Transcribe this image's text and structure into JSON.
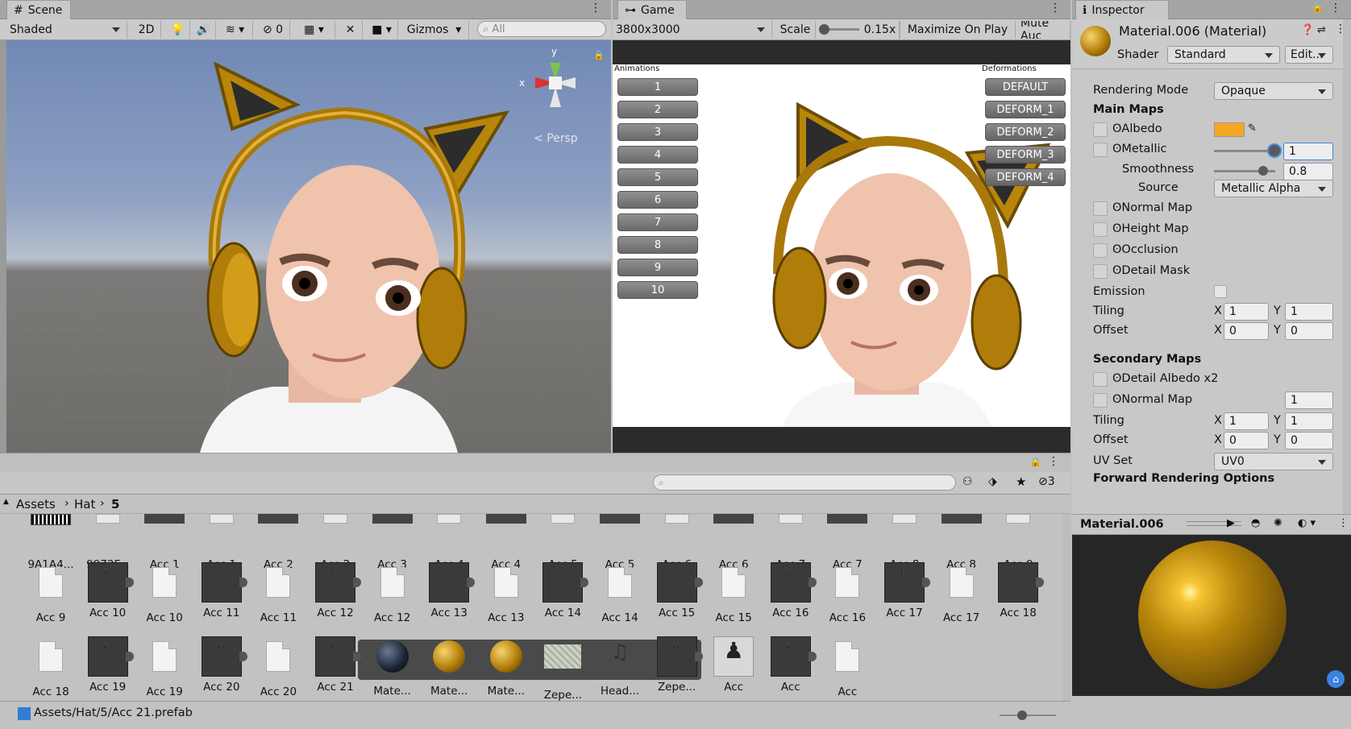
{
  "scene": {
    "tab": "Scene",
    "shading": "Shaded",
    "mode_2d": "2D",
    "hidden_count": "0",
    "gizmos": "Gizmos",
    "search_placeholder": "All",
    "axis_y": "y",
    "axis_x": "x",
    "persp": "Persp"
  },
  "game": {
    "tab": "Game",
    "resolution": "3800x3000",
    "scale_label": "Scale",
    "scale_value": "0.15x",
    "maximize": "Maximize On Play",
    "mute": "Mute Auc",
    "animations_title": "Animations",
    "deformations_title": "Deformations",
    "animations": [
      "1",
      "2",
      "3",
      "4",
      "5",
      "6",
      "7",
      "8",
      "9",
      "10"
    ],
    "deformations": [
      "DEFAULT",
      "DEFORM_1",
      "DEFORM_2",
      "DEFORM_3",
      "DEFORM_4"
    ]
  },
  "inspector": {
    "tab": "Inspector",
    "title": "Material.006 (Material)",
    "shader_label": "Shader",
    "shader": "Standard",
    "edit": "Edit...",
    "rendering_mode_label": "Rendering Mode",
    "rendering_mode": "Opaque",
    "main_maps": "Main Maps",
    "albedo": "Albedo",
    "metallic": "Metallic",
    "metallic_value": "1",
    "smoothness": "Smoothness",
    "smoothness_value": "0.8",
    "source": "Source",
    "source_value": "Metallic Alpha",
    "normal_map": "Normal Map",
    "height_map": "Height Map",
    "occlusion": "Occlusion",
    "detail_mask": "Detail Mask",
    "emission": "Emission",
    "tiling": "Tiling",
    "offset": "Offset",
    "x": "X",
    "y": "Y",
    "tiling_x": "1",
    "tiling_y": "1",
    "offset_x": "0",
    "offset_y": "0",
    "secondary_maps": "Secondary Maps",
    "detail_albedo": "Detail Albedo x2",
    "normal_map2": "Normal Map",
    "normal_map2_value": "1",
    "tiling2_x": "1",
    "tiling2_y": "1",
    "offset2_x": "0",
    "offset2_y": "0",
    "uv_set": "UV Set",
    "uv_set_value": "UV0",
    "forward": "Forward Rendering Options",
    "preview_name": "Material.006",
    "albedo_color": "#f5a623"
  },
  "project": {
    "breadcrumb": [
      "Assets",
      "Hat",
      "5"
    ],
    "hidden_count": "3",
    "status_path": "Assets/Hat/5/Acc 21.prefab",
    "row0": [
      "9A1A4...",
      "9972F...",
      "Acc 1",
      "Acc 1",
      "Acc 2",
      "Acc 2",
      "Acc 3",
      "Acc 4",
      "Acc 4",
      "Acc 5",
      "Acc 5",
      "Acc 6",
      "Acc 6",
      "Acc 7",
      "Acc 7",
      "Acc 8",
      "Acc 8",
      "Acc 9"
    ],
    "row1": [
      "Acc 9",
      "Acc 10",
      "Acc 10",
      "Acc 11",
      "Acc 11",
      "Acc 12",
      "Acc 12",
      "Acc 13",
      "Acc 13",
      "Acc 14",
      "Acc 14",
      "Acc 15",
      "Acc 15",
      "Acc 16",
      "Acc 16",
      "Acc 17",
      "Acc 17",
      "Acc 18"
    ],
    "row2": [
      "Acc 18",
      "Acc 19",
      "Acc 19",
      "Acc 20",
      "Acc 20",
      "Acc 21",
      "Mate...",
      "Mate...",
      "Mate...",
      "Zepe...",
      "Head...",
      "Zepe...",
      "Acc",
      "Acc",
      "Acc"
    ]
  }
}
